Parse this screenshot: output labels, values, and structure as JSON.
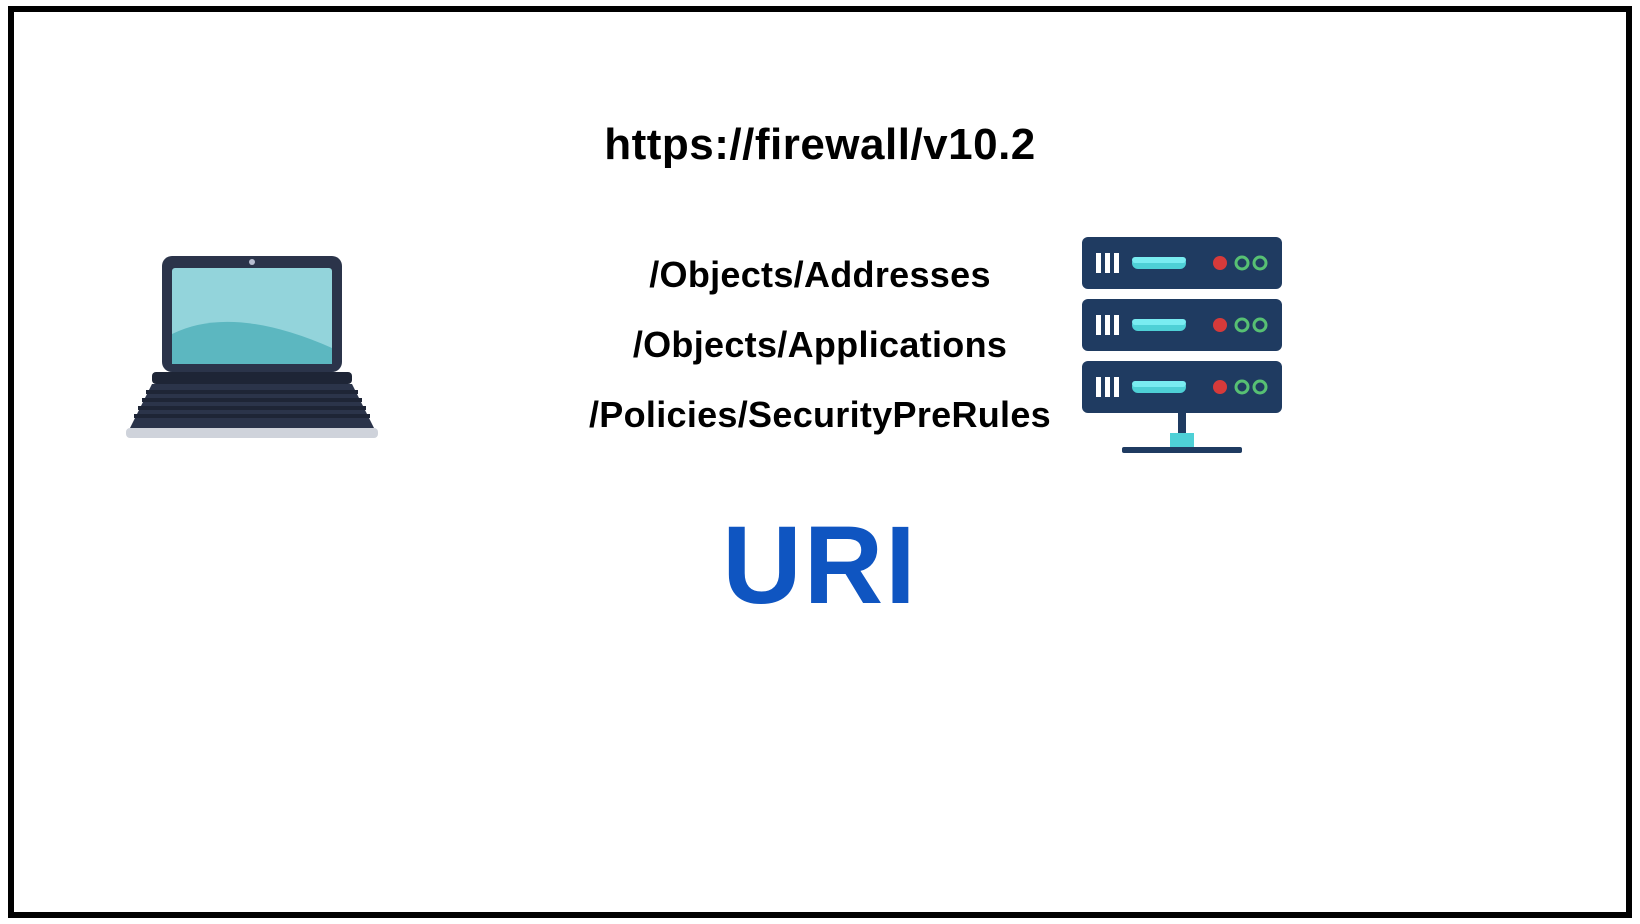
{
  "url": "https://firewall/v10.2",
  "paths": [
    "/Objects/Addresses",
    "/Objects/Applications",
    "/Policies/SecurityPreRules"
  ],
  "uri_label": "URI",
  "colors": {
    "uri_blue": "#0f55c1",
    "laptop_screen": "#93d4db",
    "laptop_screen_dark": "#5cb7c0",
    "server_body": "#1f3b61",
    "server_accent": "#4ed0d6",
    "led_red": "#d63a3a",
    "led_green": "#57c073"
  }
}
